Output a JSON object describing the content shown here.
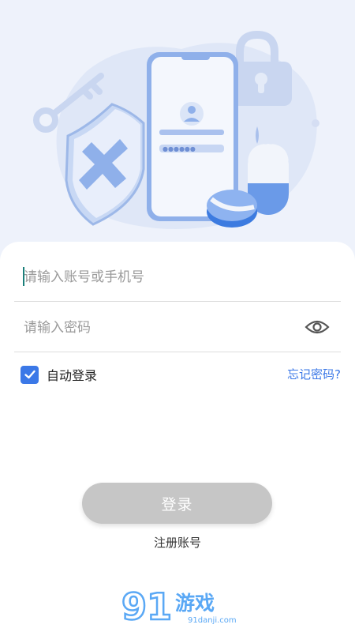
{
  "login": {
    "account_placeholder": "请输入账号或手机号",
    "password_placeholder": "请输入密码",
    "remember_label": "自动登录",
    "remember_checked": true,
    "forgot_label": "忘记密码?",
    "login_label": "登录",
    "register_label": "注册账号"
  },
  "icons": {
    "password_toggle": "eye-icon",
    "remember_check": "checkmark-icon"
  },
  "watermark": {
    "brand": "游戏",
    "site": "91danji.com"
  },
  "colors": {
    "accent": "#3b78e7",
    "button_disabled": "#c6c6c6",
    "hero_bg": "#eef2fb"
  }
}
